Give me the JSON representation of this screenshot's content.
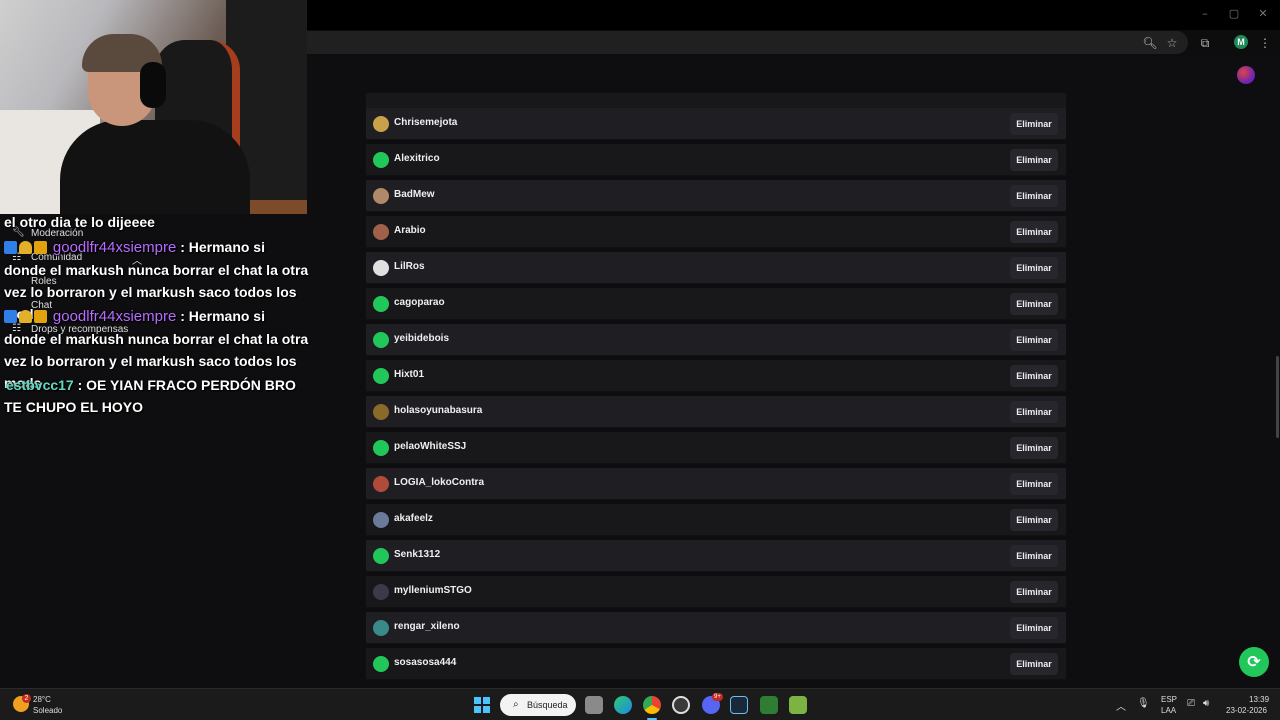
{
  "browser": {
    "window_controls": [
      "–",
      "▢",
      "✕"
    ]
  },
  "chat": {
    "lines": [
      {
        "message": "el otro dia te lo dijeeee"
      },
      {
        "user": "goodlfr44xsiempre",
        "message": ": Hermano si donde el markush nunca borrar el chat la otra vez lo borraron y el markush saco todos los mods"
      },
      {
        "user": "goodlfr44xsiempre",
        "message": ": Hermano si donde el markush nunca borrar el chat la otra vez lo borraron y el markush saco todos los mods"
      },
      {
        "user": "estbvcc17",
        "message": ": OE YIAN FRACO PERDÓN BRO TE CHUPO EL HOYO"
      }
    ],
    "menu_items": [
      "Moderación",
      "Comunidad",
      "Roles",
      "Chat",
      "Drops y recompensas"
    ]
  },
  "mods": {
    "remove_label": "Eliminar",
    "items": [
      {
        "name": "Chrisemejota",
        "avatar_color": "#c7a24a"
      },
      {
        "name": "Alexitrico",
        "avatar_color": "#21c75a"
      },
      {
        "name": "BadMew",
        "avatar_color": "#b08968"
      },
      {
        "name": "Arabio",
        "avatar_color": "#a0604a"
      },
      {
        "name": "LilRos",
        "avatar_color": "#e0e0e0"
      },
      {
        "name": "cagoparao",
        "avatar_color": "#21c75a"
      },
      {
        "name": "yeibidebois",
        "avatar_color": "#21c75a"
      },
      {
        "name": "Hixt01",
        "avatar_color": "#21c75a"
      },
      {
        "name": "holasoyunabasura",
        "avatar_color": "#8a6a2a"
      },
      {
        "name": "pelaoWhiteSSJ",
        "avatar_color": "#21c75a"
      },
      {
        "name": "LOGIA_lokoContra",
        "avatar_color": "#b04a3a"
      },
      {
        "name": "akafeelz",
        "avatar_color": "#6a7a9a"
      },
      {
        "name": "Senk1312",
        "avatar_color": "#21c75a"
      },
      {
        "name": "mylleniumSTGO",
        "avatar_color": "#3a3a4a"
      },
      {
        "name": "rengar_xileno",
        "avatar_color": "#3a8a8a"
      },
      {
        "name": "sosasosa444",
        "avatar_color": "#21c75a"
      }
    ]
  },
  "taskbar": {
    "weather_temp": "28°C",
    "weather_desc": "Soleado",
    "weather_badge": "2",
    "search_label": "Búsqueda",
    "language_top": "ESP",
    "language_bottom": "LAA",
    "time": "13:39",
    "date": "23-02-2026",
    "discord_badge": "9+"
  },
  "profile": {
    "initial": "M"
  }
}
